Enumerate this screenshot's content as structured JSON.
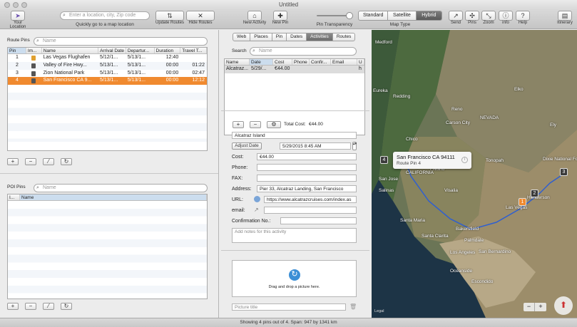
{
  "window": {
    "title": "Untitled"
  },
  "toolbar": {
    "your_location": "Your Location",
    "search_placeholder": "Enter a location, city, Zip code",
    "search_caption": "Quickly go to a map location",
    "update_routes": "Update Routes",
    "hide_routes": "Hide Routes",
    "new_activity": "New Activity",
    "new_pin": "New Pin",
    "pin_transparency": "Pin Transparency",
    "map_type_caption": "Map Type",
    "map_types": [
      "Standard",
      "Satellite",
      "Hybrid"
    ],
    "send": "Send",
    "pins": "Pins",
    "zoom": "Zoom",
    "info": "info",
    "help": "Help",
    "itinerary": "Itinerary"
  },
  "route_pins": {
    "label": "Route Pins",
    "search_placeholder": "Name",
    "columns": [
      "Pin",
      "Im...",
      "Name",
      "Arrival Date",
      "Departur...",
      "Duration",
      "Travel T..."
    ],
    "rows": [
      {
        "pin": "1",
        "name": "Las Vegas Flughafen",
        "arrival": "5/12/1...",
        "departure": "5/13/1...",
        "duration": "12:40",
        "travel": ""
      },
      {
        "pin": "2",
        "name": "Valley of Fire Hwy...",
        "arrival": "5/13/1...",
        "departure": "5/13/1...",
        "duration": "00:00",
        "travel": "01:22"
      },
      {
        "pin": "3",
        "name": "Zion National Park",
        "arrival": "5/13/1...",
        "departure": "5/13/1...",
        "duration": "00:00",
        "travel": "02:47"
      },
      {
        "pin": "4",
        "name": "San Francisco CA 9...",
        "arrival": "5/13/1...",
        "departure": "5/13/1...",
        "duration": "00:00",
        "travel": "12:12"
      }
    ]
  },
  "poi_pins": {
    "label": "POI Pins",
    "search_placeholder": "Name",
    "columns": [
      "I...",
      "Name"
    ]
  },
  "activities": {
    "tabs": [
      "Web",
      "Places",
      "Pin",
      "Dates",
      "Activities",
      "Routes"
    ],
    "active_tab": "Activities",
    "search_label": "Search",
    "search_placeholder": "Name",
    "columns": [
      "Name",
      "Date",
      "Cost",
      "Phone",
      "Confir...",
      "Email",
      "U"
    ],
    "rows": [
      {
        "name": "Alcatraz...",
        "date": "5/29/...",
        "cost": "€44.00",
        "phone": "",
        "confirm": "",
        "email": "",
        "url": "h"
      }
    ],
    "total_cost_label": "Total Cost:",
    "total_cost": "€44.00"
  },
  "detail": {
    "name": "Alcatraz Island",
    "adjust_date": "Adjust Date",
    "date_value": "5/29/2015   8:45 AM",
    "cost_label": "Cost:",
    "cost": "€44.00",
    "phone_label": "Phone:",
    "fax_label": "FAX:",
    "address_label": "Address:",
    "address": "Pier 33, Alcatraz Landing, San Francisco",
    "url_label": "URL:",
    "url": "https://www.alcatrazcruises.com/index.as",
    "email_label": "email:",
    "confirmation_label": "Confirmation No.:",
    "notes_placeholder": "Add notes for this activity"
  },
  "picture": {
    "drop_text": "Drag and drop a picture here.",
    "title_placeholder": "Picture title"
  },
  "map": {
    "callout_title": "San Francisco CA 94111",
    "callout_subtitle": "Route Pin 4",
    "labels": [
      "Medford",
      "Redding",
      "Eureka",
      "Chico",
      "Reno",
      "Carson City",
      "NEVADA",
      "CALIFORNIA",
      "San Jose",
      "Salinas",
      "Fresno",
      "Visalia",
      "Bakersfield",
      "Santa Clarita",
      "Palmdale",
      "Los Angeles",
      "San Bernardino",
      "Oceanside",
      "Escondido",
      "Henderson",
      "Las Vegas",
      "Elko",
      "Tonopah",
      "Ely",
      "Dixie National Forest",
      "Santa Maria"
    ],
    "pins": [
      "1",
      "2",
      "3",
      "4"
    ],
    "legal": "Legal"
  },
  "status": "Showing 4 pins out of 4. Span: 947 by 1341 km"
}
